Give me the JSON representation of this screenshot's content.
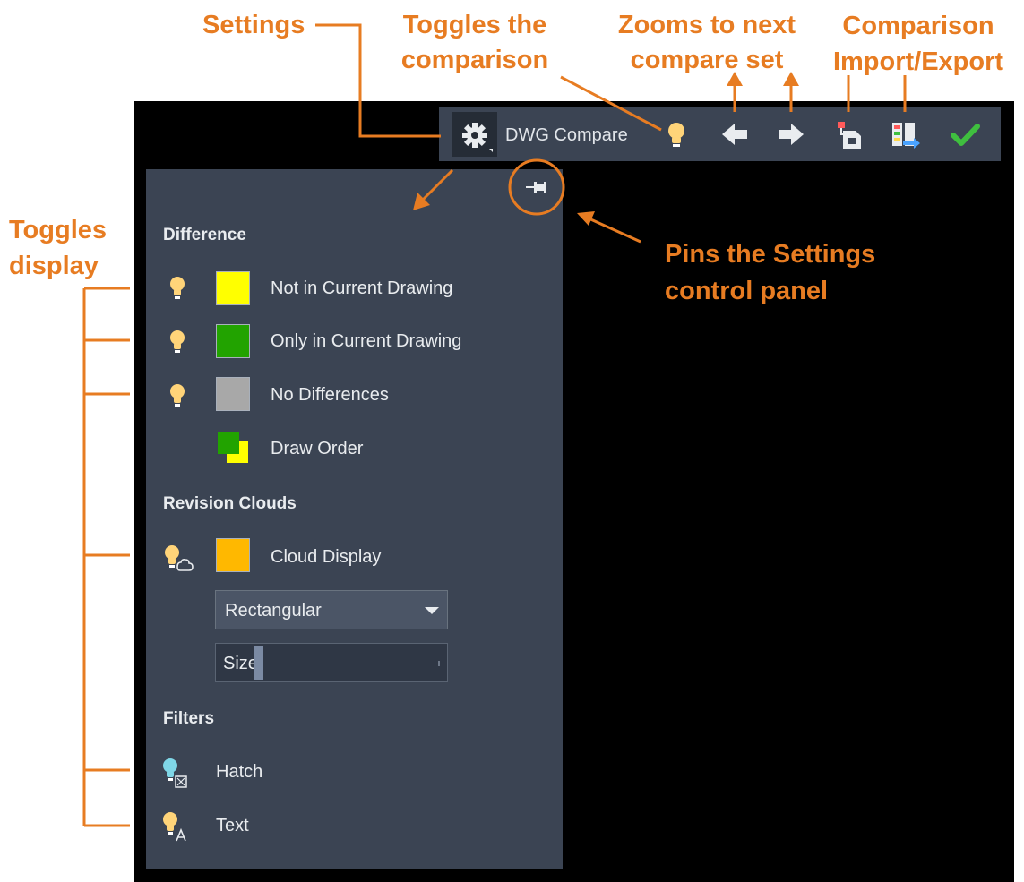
{
  "annotations": {
    "settings": "Settings",
    "toggles_comparison_1": "Toggles the",
    "toggles_comparison_2": "comparison",
    "zooms_1": "Zooms to next",
    "zooms_2": "compare set",
    "import_export_1": "Comparison",
    "import_export_2": "Import/Export",
    "toggles_display_1": "Toggles",
    "toggles_display_2": "display",
    "pins_1": "Pins the Settings",
    "pins_2": "control panel"
  },
  "toolbar": {
    "title": "DWG Compare"
  },
  "panel": {
    "difference_header": "Difference",
    "rows": [
      {
        "label": "Not in Current Drawing",
        "color": "#ffff00"
      },
      {
        "label": "Only in Current Drawing",
        "color": "#22a300"
      },
      {
        "label": "No Differences",
        "color": "#a8a8a8"
      },
      {
        "label": "Draw Order"
      }
    ],
    "revision_header": "Revision Clouds",
    "cloud_display": {
      "label": "Cloud Display",
      "color": "#ffb800"
    },
    "cloud_shape": "Rectangular",
    "size_label": "Size",
    "size_value_percent": 0.12,
    "filters_header": "Filters",
    "filters": [
      {
        "label": "Hatch"
      },
      {
        "label": "Text"
      }
    ]
  },
  "colors": {
    "annotation": "#e77c22",
    "panel_bg": "#3b4453",
    "bulb": "#ffd479",
    "bulb_hatch": "#7fd6e6",
    "check": "#3fbf3f"
  }
}
